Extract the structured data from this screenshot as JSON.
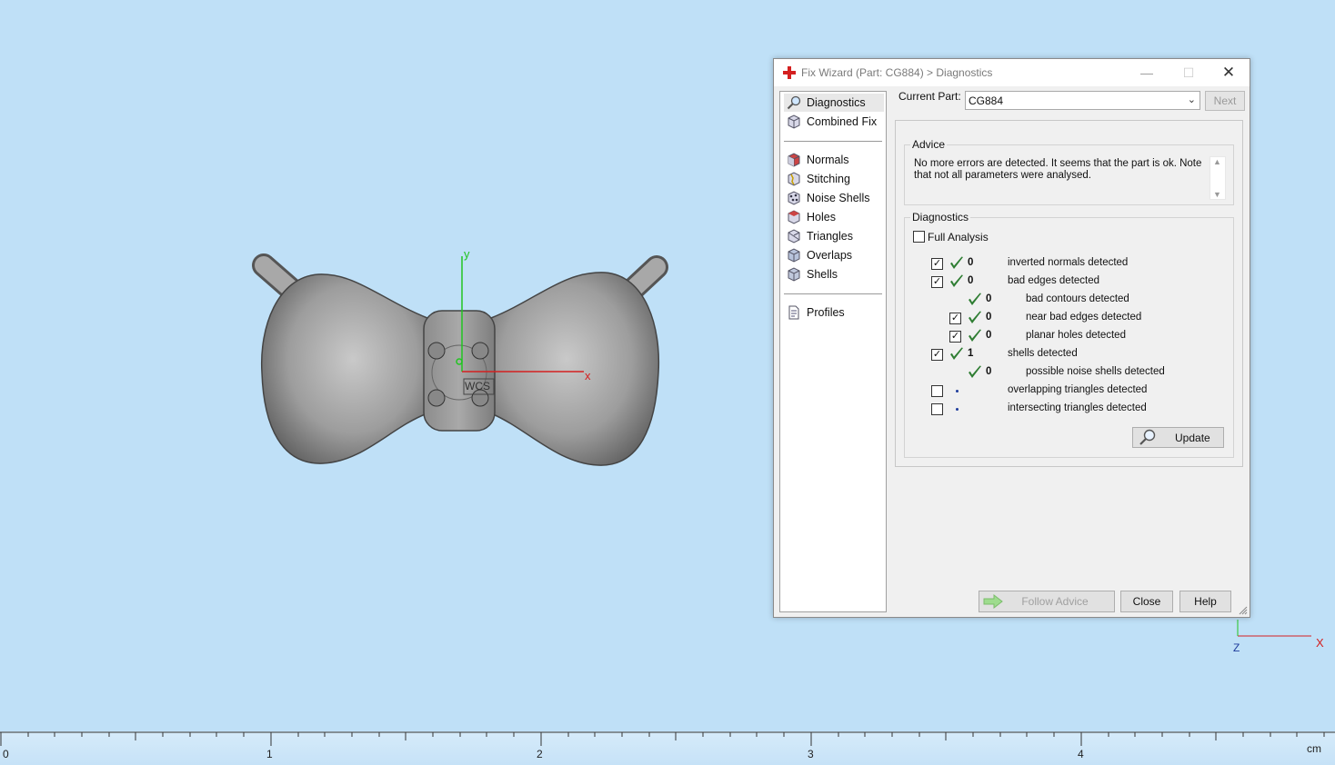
{
  "viewport": {
    "axes": {
      "x": "x",
      "y": "y",
      "wcs": "WCS"
    },
    "corner_axes": {
      "z": "Z",
      "x": "X"
    }
  },
  "ruler": {
    "marks": [
      "0",
      "1",
      "2",
      "3",
      "4"
    ],
    "unit": "cm"
  },
  "dialog": {
    "title": "Fix Wizard (Part: CG884) > Diagnostics",
    "nav": {
      "group1": [
        {
          "label": "Diagnostics",
          "icon": "magnifier-icon",
          "active": true
        },
        {
          "label": "Combined Fix",
          "icon": "combined-fix-icon"
        }
      ],
      "group2": [
        {
          "label": "Normals",
          "icon": "normals-icon"
        },
        {
          "label": "Stitching",
          "icon": "stitching-icon"
        },
        {
          "label": "Noise Shells",
          "icon": "noise-shells-icon"
        },
        {
          "label": "Holes",
          "icon": "holes-icon"
        },
        {
          "label": "Triangles",
          "icon": "triangles-icon"
        },
        {
          "label": "Overlaps",
          "icon": "overlaps-icon"
        },
        {
          "label": "Shells",
          "icon": "shells-icon"
        }
      ],
      "group3": [
        {
          "label": "Profiles",
          "icon": "profiles-icon"
        }
      ]
    },
    "current_part_label": "Current Part:",
    "current_part_value": "CG884",
    "next_label": "Next",
    "advice": {
      "title": "Advice",
      "text": "No more errors are detected. It seems that the part is ok. Note that not all parameters were analysed."
    },
    "diagnostics": {
      "title": "Diagnostics",
      "full_analysis_label": "Full Analysis",
      "rows": [
        {
          "checked": true,
          "status": "ok",
          "count": "0",
          "label": "inverted normals detected",
          "indent": 0,
          "has_checkbox": true
        },
        {
          "checked": true,
          "status": "ok",
          "count": "0",
          "label": "bad edges detected",
          "indent": 0,
          "has_checkbox": true
        },
        {
          "checked": false,
          "status": "ok",
          "count": "0",
          "label": "bad contours detected",
          "indent": 1,
          "has_checkbox": false
        },
        {
          "checked": true,
          "status": "ok",
          "count": "0",
          "label": "near bad edges detected",
          "indent": 1,
          "has_checkbox": true
        },
        {
          "checked": true,
          "status": "ok",
          "count": "0",
          "label": "planar holes detected",
          "indent": 1,
          "has_checkbox": true
        },
        {
          "checked": true,
          "status": "ok",
          "count": "1",
          "label": "shells detected",
          "indent": 0,
          "has_checkbox": true
        },
        {
          "checked": false,
          "status": "ok",
          "count": "0",
          "label": "possible noise shells detected",
          "indent": 1,
          "has_checkbox": false
        },
        {
          "checked": false,
          "status": "dot",
          "count": "",
          "label": "overlapping triangles detected",
          "indent": 0,
          "has_checkbox": true
        },
        {
          "checked": false,
          "status": "dot",
          "count": "",
          "label": "intersecting triangles detected",
          "indent": 0,
          "has_checkbox": true
        }
      ],
      "update_label": "Update"
    },
    "buttons": {
      "follow_advice": "Follow Advice",
      "close": "Close",
      "help": "Help"
    }
  },
  "colors": {
    "background": "#bfe0f7",
    "x_axis": "#d42020",
    "y_axis": "#22c422",
    "check": "#2e7d32"
  }
}
